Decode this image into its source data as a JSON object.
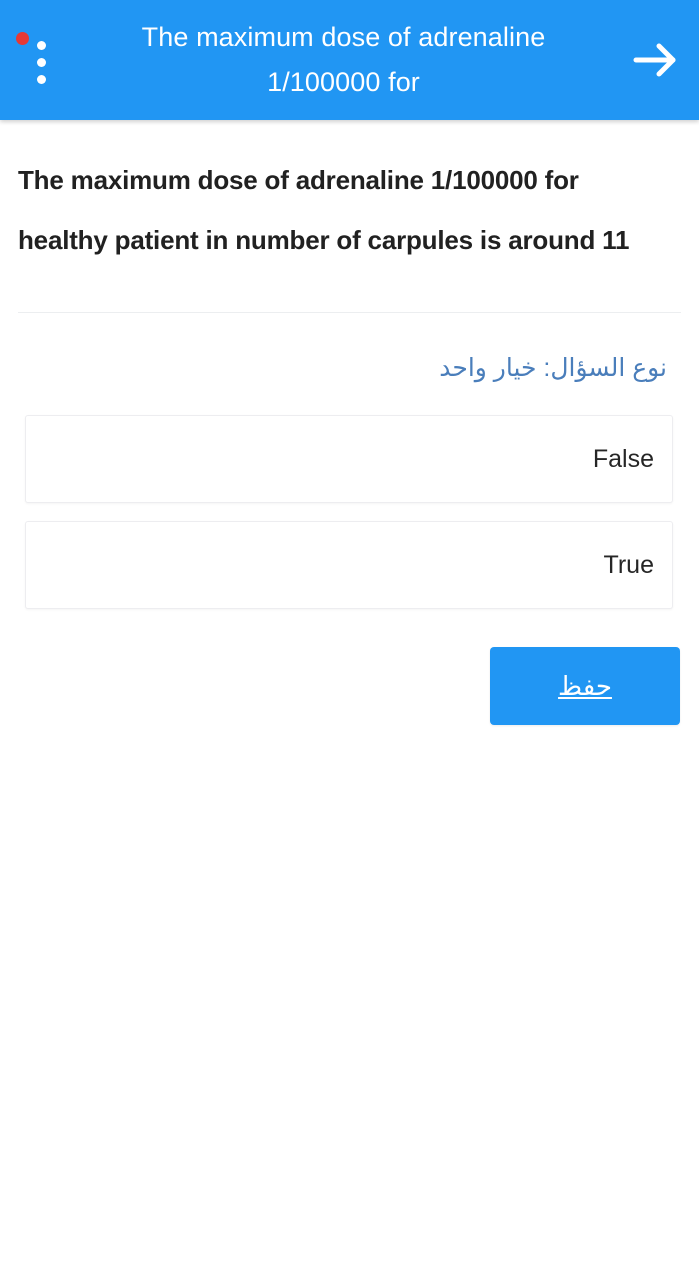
{
  "appbar": {
    "title": "The maximum dose of adrenaline 1/100000 for",
    "overflow_icon": "overflow-menu-vertical-icon",
    "notification_badge_color": "#e53935",
    "next_icon": "arrow-right-icon",
    "background_color": "#2196f3",
    "title_color": "#ffffff"
  },
  "question": {
    "text": "The maximum dose of adrenaline 1/100000 for healthy patient in number of carpules is around 11",
    "type_label": "نوع السؤال: خيار واحد",
    "type_label_color": "#4a7ebb"
  },
  "options": [
    {
      "label": "False",
      "selected": false
    },
    {
      "label": "True",
      "selected": false
    }
  ],
  "actions": {
    "save_label": "حفظ",
    "save_color": "#2196f3"
  }
}
